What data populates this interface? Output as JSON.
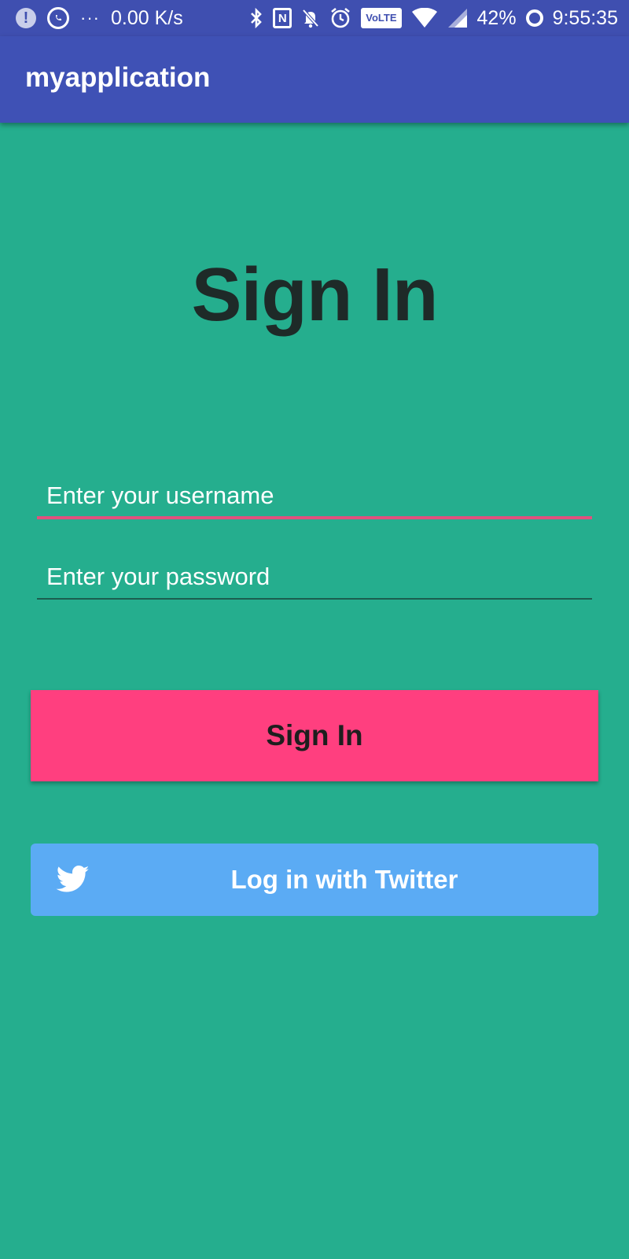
{
  "status_bar": {
    "alert_icon": "alert-circle-icon",
    "whatsapp_icon": "whatsapp-icon",
    "more_dots": "···",
    "speed": "0.00 K/s",
    "volte": "VoLTE",
    "battery": "42%",
    "time": "9:55:35"
  },
  "app_bar": {
    "title": "myapplication"
  },
  "main": {
    "headline": "Sign In",
    "username_placeholder": "Enter your username",
    "password_placeholder": "Enter your password",
    "sign_in_label": "Sign In",
    "twitter_label": "Log in with Twitter"
  },
  "colors": {
    "background": "#25AE8E",
    "app_bar": "#3F51B5",
    "accent": "#FF3F7F",
    "twitter": "#5BABF4"
  }
}
